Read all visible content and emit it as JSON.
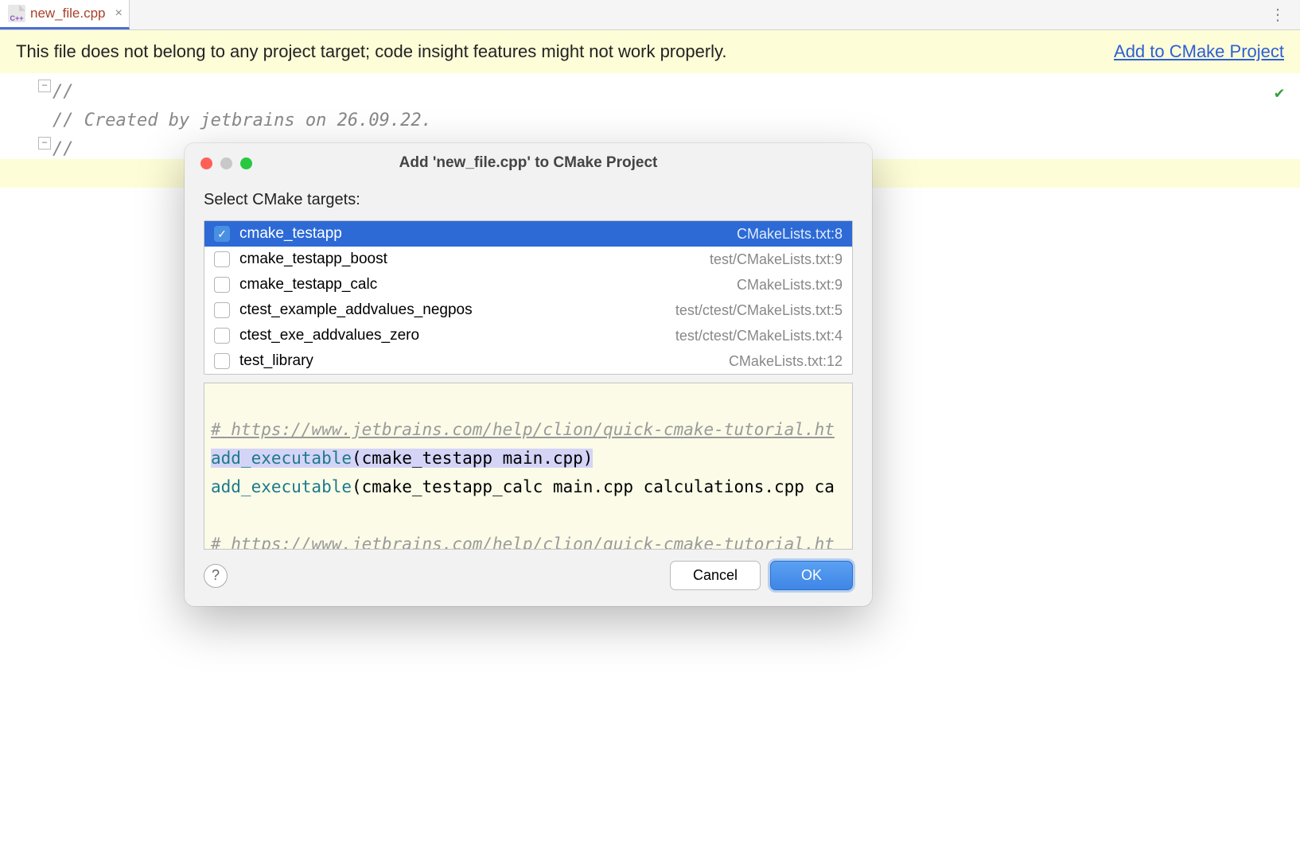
{
  "tab": {
    "filename": "new_file.cpp"
  },
  "banner": {
    "text": "This file does not belong to any project target; code insight features might not work properly.",
    "link": "Add to CMake Project"
  },
  "code": {
    "line1": "//",
    "line2": "// Created by jetbrains on 26.09.22.",
    "line3": "//"
  },
  "dialog": {
    "title": "Add 'new_file.cpp' to CMake Project",
    "label": "Select CMake targets:",
    "targets": [
      {
        "name": "cmake_testapp",
        "loc": "CMakeLists.txt:8",
        "selected": true
      },
      {
        "name": "cmake_testapp_boost",
        "loc": "test/CMakeLists.txt:9",
        "selected": false
      },
      {
        "name": "cmake_testapp_calc",
        "loc": "CMakeLists.txt:9",
        "selected": false
      },
      {
        "name": "ctest_example_addvalues_negpos",
        "loc": "test/ctest/CMakeLists.txt:5",
        "selected": false
      },
      {
        "name": "ctest_exe_addvalues_zero",
        "loc": "test/ctest/CMakeLists.txt:4",
        "selected": false
      },
      {
        "name": "test_library",
        "loc": "CMakeLists.txt:12",
        "selected": false
      }
    ],
    "preview": {
      "comment1": "# https://www.jetbrains.com/help/clion/quick-cmake-tutorial.ht",
      "kw": "add_executable",
      "hl_args": "(cmake_testapp main.cpp)",
      "line2_args": "(cmake_testapp_calc main.cpp calculations.cpp ca",
      "comment2": "# https://www.jetbrains.com/help/clion/quick-cmake-tutorial.ht"
    },
    "cancel": "Cancel",
    "ok": "OK"
  }
}
